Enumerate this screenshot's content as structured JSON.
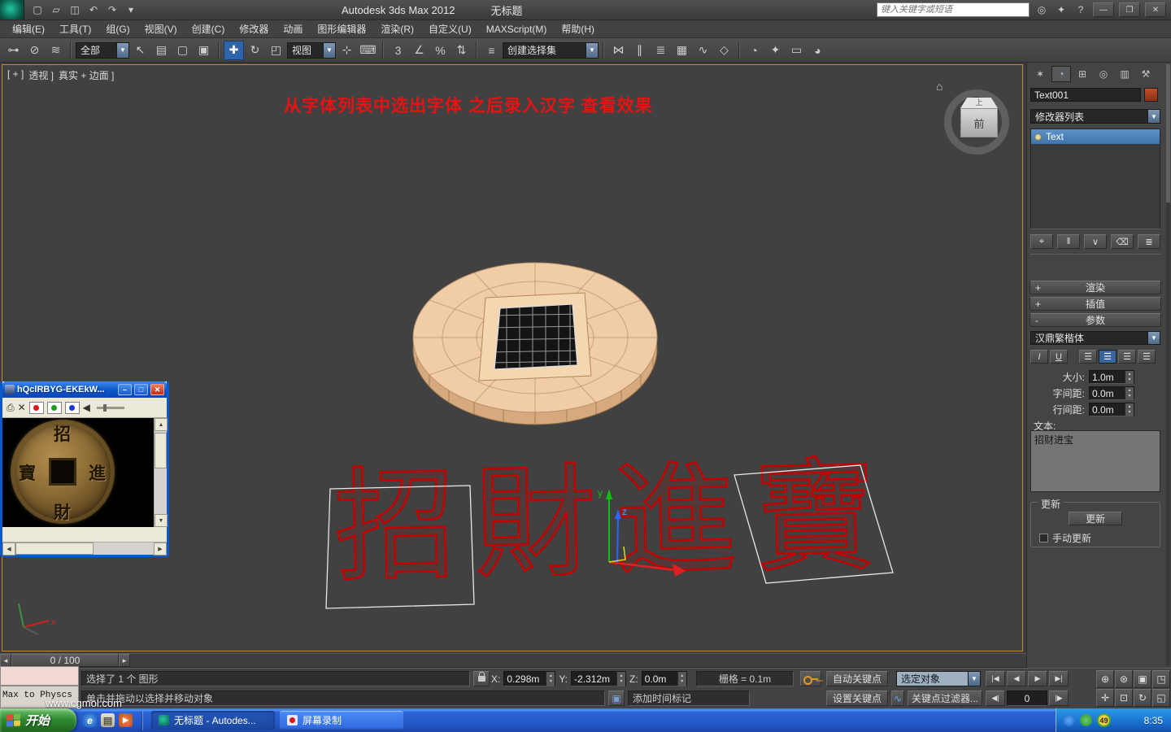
{
  "title_bar": {
    "app_title": "Autodesk 3ds Max  2012",
    "doc_title": "无标题",
    "search_placeholder": "键入关键字或短语",
    "qat": {
      "new_glyph": "▢",
      "open_glyph": "▱",
      "save_glyph": "◫",
      "undo_glyph": "↶",
      "redo_glyph": "↷",
      "arrow_glyph": "▾"
    },
    "infocenter": {
      "comm_glyph": "◎",
      "fav_glyph": "✦",
      "help_glyph": "?"
    },
    "window_controls": {
      "minimize": "—",
      "restore": "❐",
      "close": "✕"
    }
  },
  "menus": [
    "编辑(E)",
    "工具(T)",
    "组(G)",
    "视图(V)",
    "创建(C)",
    "修改器",
    "动画",
    "图形编辑器",
    "渲染(R)",
    "自定义(U)",
    "MAXScript(M)",
    "帮助(H)"
  ],
  "main_toolbar": {
    "filter_value": "全部",
    "view_value": "视图",
    "named_set_value": "创建选择集",
    "icons": [
      {
        "name": "select-and-link",
        "glyph": "⊶"
      },
      {
        "name": "unlink-selection",
        "glyph": "⊘"
      },
      {
        "name": "bind-to-space-warp",
        "glyph": "≋"
      },
      {
        "name": "select-object",
        "glyph": "↖"
      },
      {
        "name": "select-by-name",
        "glyph": "▤"
      },
      {
        "name": "rectangular-selection-region",
        "glyph": "▢"
      },
      {
        "name": "window-crossing-toggle",
        "glyph": "▣"
      },
      {
        "name": "select-and-move",
        "glyph": "✚"
      },
      {
        "name": "select-and-rotate",
        "glyph": "↻"
      },
      {
        "name": "select-and-scale",
        "glyph": "◰"
      },
      {
        "name": "select-and-manipulate",
        "glyph": "⊹"
      },
      {
        "name": "keyboard-shortcut-override",
        "glyph": "⌨"
      },
      {
        "name": "snap-toggle-3d",
        "glyph": "3"
      },
      {
        "name": "angle-snap-toggle",
        "glyph": "∠"
      },
      {
        "name": "percent-snap-toggle",
        "glyph": "%"
      },
      {
        "name": "spinner-snap-toggle",
        "glyph": "⇅"
      },
      {
        "name": "edit-named-selection-sets",
        "glyph": "≡"
      },
      {
        "name": "mirror",
        "glyph": "⋈"
      },
      {
        "name": "align",
        "glyph": "∥"
      },
      {
        "name": "layer-manager",
        "glyph": "≣"
      },
      {
        "name": "graphite-ribbon",
        "glyph": "▦"
      },
      {
        "name": "curve-editor",
        "glyph": "∿"
      },
      {
        "name": "schematic-view",
        "glyph": "◇"
      },
      {
        "name": "material-editor",
        "glyph": "◔"
      },
      {
        "name": "render-setup",
        "glyph": "✦"
      },
      {
        "name": "rendered-frame-window",
        "glyph": "▭"
      },
      {
        "name": "render-production",
        "glyph": "◕"
      }
    ]
  },
  "viewport": {
    "label_general": "[ + ]",
    "label_pov": "透视 ]",
    "label_shading": "真实 + 边面 ]",
    "hint": "从字体列表中选出字体 之后录入汉字 查看效果",
    "wire_text": "招財進寶",
    "viewcube": {
      "front": "前",
      "top": "上",
      "home_glyph": "⌂"
    },
    "axis": {
      "x": "x",
      "y": "y",
      "z": "z"
    }
  },
  "player": {
    "title": "hQclRBYG-EKEkW...",
    "coin": {
      "top": "招",
      "right": "進",
      "bottom": "財",
      "left": "寶"
    },
    "controls": {
      "print_glyph": "⎙",
      "close_glyph": "✕",
      "up_glyph": "▲",
      "down_glyph": "▼",
      "left_glyph": "◀",
      "right_glyph": "▶"
    },
    "window_controls": {
      "minimize": "–",
      "restore": "□",
      "close": "✕"
    }
  },
  "command_panel": {
    "tabs": [
      {
        "name": "create",
        "glyph": "✶"
      },
      {
        "name": "modify",
        "glyph": "◔"
      },
      {
        "name": "hierarchy",
        "glyph": "⊞"
      },
      {
        "name": "motion",
        "glyph": "◎"
      },
      {
        "name": "display",
        "glyph": "▥"
      },
      {
        "name": "utilities",
        "glyph": "⚒"
      }
    ],
    "object_name": "Text001",
    "modifier_list_label": "修改器列表",
    "stack_item": "Text",
    "stack_buttons": [
      {
        "name": "pin-stack",
        "glyph": "⌖"
      },
      {
        "name": "show-end-result",
        "glyph": "‖"
      },
      {
        "name": "make-unique",
        "glyph": "∨"
      },
      {
        "name": "remove-modifier",
        "glyph": "⌫"
      },
      {
        "name": "configure-modifier-sets",
        "glyph": "≣"
      }
    ],
    "rollouts": {
      "rendering": {
        "sign": "+",
        "label": "渲染"
      },
      "interpolation": {
        "sign": "+",
        "label": "插值"
      },
      "parameters": {
        "sign": "-",
        "label": "参数"
      }
    },
    "font_name": "汉鼎繁楷体",
    "style": {
      "italic": "I",
      "underline": "U",
      "align_glyph": "☰"
    },
    "params": {
      "size_label": "大小:",
      "size_value": "1.0m",
      "kerning_label": "字间距:",
      "kerning_value": "0.0m",
      "leading_label": "行间距:",
      "leading_value": "0.0m",
      "text_label": "文本:",
      "text_value": "招财进宝"
    },
    "update": {
      "group_label": "更新",
      "button": "更新",
      "manual": "手动更新"
    }
  },
  "timeline": {
    "prev_glyph": "◂",
    "handle": "0 / 100",
    "next_glyph": "▸"
  },
  "status_bar": {
    "selection": "选择了 1 个 图形",
    "prompt": "单击并拖动以选择并移动对象",
    "x_label": "X:",
    "x_value": "0.298m",
    "y_label": "Y:",
    "y_value": "-2.312m",
    "z_label": "Z:",
    "z_value": "0.0m",
    "grid_text": "栅格 = 0.1m",
    "time_tag": "添加时间标记",
    "time_tag_glyph": "▣",
    "auto_key": "自动关键点",
    "set_key": "设置关键点",
    "selected_combo": "选定对象",
    "key_filters": "关键点过滤器...",
    "key_filters_glyph": "∿",
    "frame": "0",
    "playback": {
      "start": "|◀",
      "prev": "◀",
      "play": "▶",
      "end": "▶|",
      "prev_key": "◀|",
      "next_key": "|▶"
    },
    "nav": [
      "⊕",
      "⊛",
      "▣",
      "◳",
      "✛",
      "⊡",
      "↻",
      "◱"
    ]
  },
  "mini_listener": {
    "text": "Max to Physcs ("
  },
  "taskbar": {
    "start_label": "开始",
    "watermark": "www.cgmol.com",
    "quick_launch": [
      {
        "name": "internet-explorer",
        "glyph": "e"
      },
      {
        "name": "show-desktop",
        "glyph": "▤"
      },
      {
        "name": "media-player",
        "glyph": "▶"
      }
    ],
    "tasks": [
      {
        "label": "无标题 - Autodes..."
      },
      {
        "label": "屏幕录制"
      }
    ],
    "tray": {
      "badge": "49",
      "time": "8:35"
    }
  },
  "colors": {
    "viewport_border": "#c8892b",
    "selection_blue": "#3f74ab",
    "wire_text_red": "#c40000",
    "hint_red": "#e81212",
    "xp_taskbar_blue": "#2458c8",
    "start_green": "#2f8a2f",
    "coin_fill": "#f0cda6"
  }
}
